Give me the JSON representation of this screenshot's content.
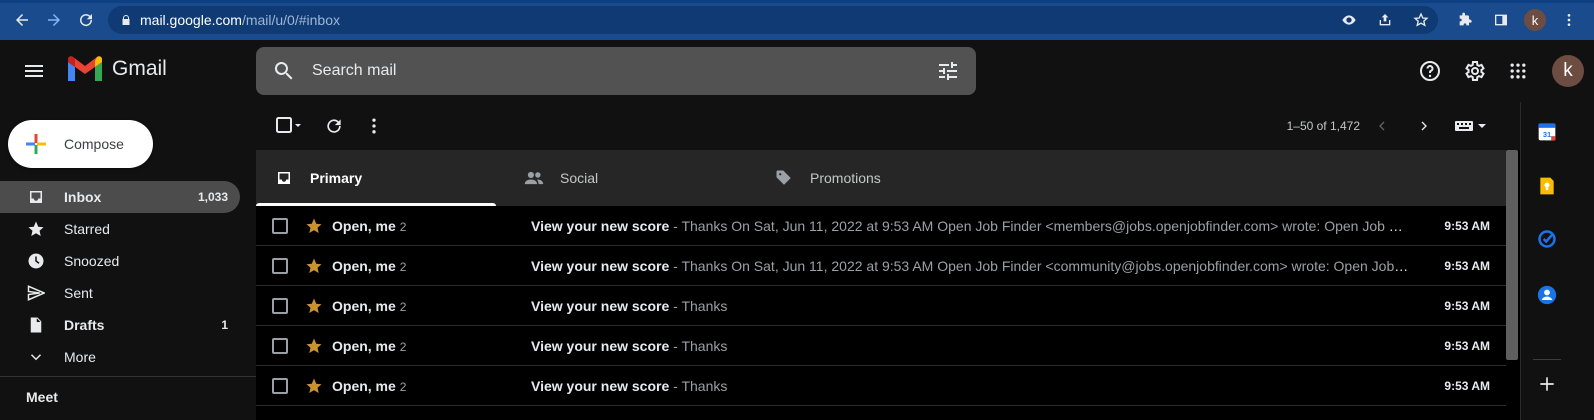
{
  "browser": {
    "url_host": "mail.google.com",
    "url_path": "/mail/u/0/#inbox",
    "profile_initial": "k"
  },
  "header": {
    "app_name": "Gmail",
    "search_placeholder": "Search mail",
    "avatar_initial": "k"
  },
  "sidebar": {
    "compose_label": "Compose",
    "items": [
      {
        "label": "Inbox",
        "count": "1,033",
        "icon": "inbox-icon",
        "active": true
      },
      {
        "label": "Starred",
        "count": "",
        "icon": "star-icon"
      },
      {
        "label": "Snoozed",
        "count": "",
        "icon": "clock-icon"
      },
      {
        "label": "Sent",
        "count": "",
        "icon": "send-icon"
      },
      {
        "label": "Drafts",
        "count": "1",
        "icon": "draft-icon"
      },
      {
        "label": "More",
        "count": "",
        "icon": "chevron-down-icon"
      }
    ],
    "meet_label": "Meet"
  },
  "toolbar": {
    "pager_text": "1–50 of 1,472"
  },
  "tabs": [
    {
      "label": "Primary",
      "icon": "inbox-icon",
      "active": true
    },
    {
      "label": "Social",
      "icon": "people-icon"
    },
    {
      "label": "Promotions",
      "icon": "tag-icon"
    }
  ],
  "emails": [
    {
      "sender": "Open, me",
      "count": "2",
      "subject": "View your new score",
      "snippet": " - Thanks On Sat, Jun 11, 2022 at 9:53 AM Open Job Finder <members@jobs.openjobfinder.com> wrote: Open Job Finder Job Finder",
      "time": "9:53 AM"
    },
    {
      "sender": "Open, me",
      "count": "2",
      "subject": "View your new score",
      "snippet": " - Thanks On Sat, Jun 11, 2022 at 9:53 AM Open Job Finder <community@jobs.openjobfinder.com> wrote: Open Job Finder Job Finder",
      "time": "9:53 AM"
    },
    {
      "sender": "Open, me",
      "count": "2",
      "subject": "View your new score",
      "snippet": " - Thanks",
      "time": "9:53 AM"
    },
    {
      "sender": "Open, me",
      "count": "2",
      "subject": "View your new score",
      "snippet": " - Thanks",
      "time": "9:53 AM"
    },
    {
      "sender": "Open, me",
      "count": "2",
      "subject": "View your new score",
      "snippet": " - Thanks",
      "time": "9:53 AM"
    }
  ],
  "colors": {
    "star": "#c7922f",
    "calendar": "#1a73e8",
    "keep": "#fbbc04",
    "tasks": "#1a73e8",
    "contacts": "#1a73e8"
  }
}
